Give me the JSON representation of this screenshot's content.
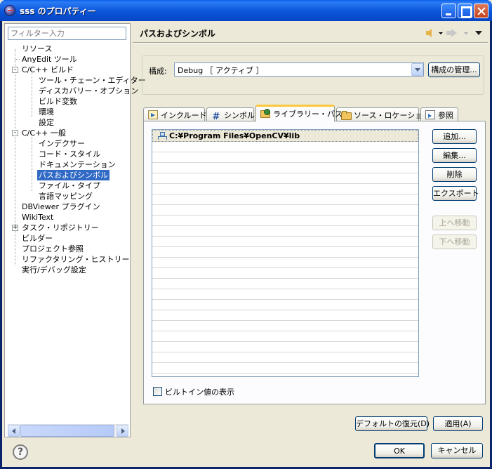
{
  "window": {
    "title": "sss のプロパティー"
  },
  "left": {
    "filter_placeholder": "フィルター入力",
    "tree": [
      {
        "label": "リソース"
      },
      {
        "label": "AnyEdit ツール"
      },
      {
        "label": "C/C++ ビルド",
        "expander": "-"
      },
      {
        "label": "ツール・チェーン・エディター"
      },
      {
        "label": "ディスカバリー・オプション"
      },
      {
        "label": "ビルド変数"
      },
      {
        "label": "環境"
      },
      {
        "label": "設定"
      },
      {
        "label": "C/C++ 一般",
        "expander": "-"
      },
      {
        "label": "インデクサー"
      },
      {
        "label": "コード・スタイル"
      },
      {
        "label": "ドキュメンテーション"
      },
      {
        "label": "パスおよびシンボル",
        "selected": true
      },
      {
        "label": "ファイル・タイプ"
      },
      {
        "label": "言語マッピング"
      },
      {
        "label": "DBViewer プラグイン"
      },
      {
        "label": "WikiText"
      },
      {
        "label": "タスク・リポジトリー",
        "expander": "+"
      },
      {
        "label": "ビルダー"
      },
      {
        "label": "プロジェクト参照"
      },
      {
        "label": "リファクタリング・ヒストリー"
      },
      {
        "label": "実行/デバッグ設定"
      }
    ]
  },
  "right": {
    "page_title": "パスおよびシンボル",
    "config_label": "構成:",
    "config_value": "Debug ［ アクティブ ］",
    "manage_button": "構成の管理...",
    "tabs": [
      {
        "label": "インクルード",
        "icon": "include-icon"
      },
      {
        "label": "シンボル",
        "icon": "hash-icon"
      },
      {
        "label": "ライブラリー・パス",
        "icon": "library-icon",
        "active": true
      },
      {
        "label": "ソース・ロケーション",
        "icon": "folder-icon"
      },
      {
        "label": "参照",
        "icon": "reference-icon"
      }
    ],
    "library_paths": [
      "C:¥Program Files¥OpenCV¥lib"
    ],
    "side_buttons": {
      "add": "追加...",
      "edit": "編集...",
      "delete": "削除",
      "export": "エクスポート",
      "move_up": "上へ移動",
      "move_down": "下へ移動"
    },
    "builtin_checkbox": "ビルトイン値の表示",
    "restore_defaults": "デフォルトの復元(D)",
    "apply": "適用(A)"
  },
  "footer": {
    "ok": "OK",
    "cancel": "キャンセル"
  },
  "colors": {
    "title_bar": "#0A55D9",
    "selection": "#316AC5",
    "active_tab_accent": "#FFC83C"
  }
}
